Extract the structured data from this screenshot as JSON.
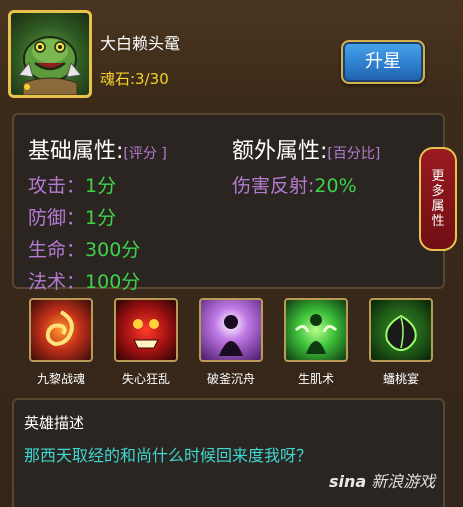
{
  "hero": {
    "name": "大白赖头鼋",
    "soul_stone": "魂石:3/30",
    "upgrade_label": "升星"
  },
  "attributes": {
    "base_title": "基础属性:",
    "base_sub": "[评分 ]",
    "extra_title": "额外属性:",
    "extra_sub": "[百分比]",
    "base": [
      {
        "label": "攻击：",
        "value": "1分"
      },
      {
        "label": "防御：",
        "value": "1分"
      },
      {
        "label": "生命：",
        "value": "300分"
      },
      {
        "label": "法术：",
        "value": "100分"
      }
    ],
    "extra": [
      {
        "label": "伤害反射:",
        "value": "20%"
      }
    ],
    "more_label": [
      "更",
      "多",
      "属",
      "性"
    ]
  },
  "skills": [
    {
      "name": "九黎战魂",
      "icon": "fire-spirit-icon"
    },
    {
      "name": "失心狂乱",
      "icon": "rage-face-icon"
    },
    {
      "name": "破釜沉舟",
      "icon": "dark-figure-icon"
    },
    {
      "name": "生肌术",
      "icon": "heal-figure-icon"
    },
    {
      "name": "蟠桃宴",
      "icon": "peach-icon"
    }
  ],
  "description": {
    "title": "英雄描述",
    "text": "那西天取经的和尚什么时候回来度我呀？"
  },
  "watermark": {
    "brand": "sina",
    "text": "新浪游戏"
  },
  "colors": {
    "attr_label": "#b47ad2",
    "attr_value": "#3fd24a",
    "soul": "#f4d22a",
    "desc_text": "#3ed7d0"
  }
}
